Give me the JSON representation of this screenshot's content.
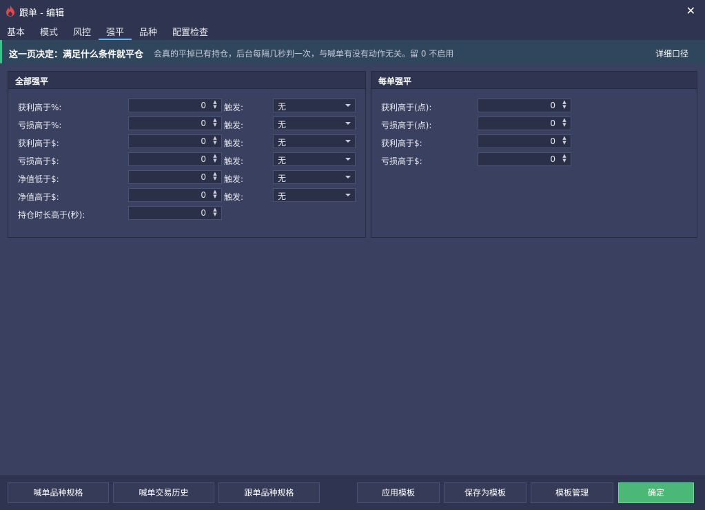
{
  "window": {
    "title": "跟单 - 编辑",
    "close": "✕"
  },
  "tabs": [
    "基本",
    "模式",
    "风控",
    "强平",
    "品种",
    "配置检查"
  ],
  "active_tab": "强平",
  "banner": {
    "bold": "这一页决定：满足什么条件就平仓",
    "desc": "会真的平掉已有持仓，后台每隔几秒判一次，与喊单有没有动作无关。留 0 不启用",
    "link": "详细口径"
  },
  "all": {
    "title": "全部强平",
    "trigger_label": "触发:",
    "rows": [
      {
        "label": "获利高于%:",
        "value": "0",
        "trigger": "无"
      },
      {
        "label": "亏损高于%:",
        "value": "0",
        "trigger": "无"
      },
      {
        "label": "获利高于$:",
        "value": "0",
        "trigger": "无"
      },
      {
        "label": "亏损高于$:",
        "value": "0",
        "trigger": "无"
      },
      {
        "label": "净值低于$:",
        "value": "0",
        "trigger": "无"
      },
      {
        "label": "净值高于$:",
        "value": "0",
        "trigger": "无"
      },
      {
        "label": "持仓时长高于(秒):",
        "value": "0"
      }
    ]
  },
  "each": {
    "title": "每单强平",
    "rows": [
      {
        "label": "获利高于(点):",
        "value": "0"
      },
      {
        "label": "亏损高于(点):",
        "value": "0"
      },
      {
        "label": "获利高于$:",
        "value": "0"
      },
      {
        "label": "亏损高于$:",
        "value": "0"
      }
    ]
  },
  "footer": {
    "left": [
      "喊单品种规格",
      "喊单交易历史",
      "跟单品种规格"
    ],
    "right": [
      "应用模板",
      "保存为模板",
      "模板管理",
      "确定"
    ]
  },
  "icons": {
    "app": "flame-icon",
    "close": "close-icon",
    "spin": "spinner-icon",
    "caret": "dropdown-caret-icon"
  },
  "colors": {
    "accent": "#6fb3ff",
    "banner_stripe": "#3fbf8a",
    "confirm": "#4cb877"
  }
}
